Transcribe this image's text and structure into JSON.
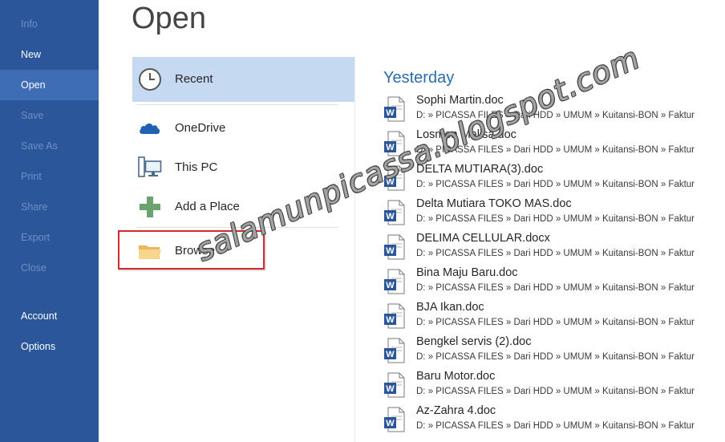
{
  "sidebar": {
    "items": [
      {
        "label": "Info",
        "state": "disabled"
      },
      {
        "label": "New",
        "state": "normal"
      },
      {
        "label": "Open",
        "state": "active"
      },
      {
        "label": "Save",
        "state": "disabled"
      },
      {
        "label": "Save As",
        "state": "disabled"
      },
      {
        "label": "Print",
        "state": "disabled"
      },
      {
        "label": "Share",
        "state": "disabled"
      },
      {
        "label": "Export",
        "state": "disabled"
      },
      {
        "label": "Close",
        "state": "disabled"
      },
      {
        "label": "Account",
        "state": "normal"
      },
      {
        "label": "Options",
        "state": "normal"
      }
    ]
  },
  "page": {
    "title": "Open"
  },
  "places": [
    {
      "label": "Recent",
      "icon": "clock-icon",
      "selected": true
    },
    {
      "label": "OneDrive",
      "icon": "cloud-icon"
    },
    {
      "label": "This PC",
      "icon": "computer-icon"
    },
    {
      "label": "Add a Place",
      "icon": "plus-icon"
    },
    {
      "label": "Browse",
      "icon": "folder-icon"
    }
  ],
  "recent": {
    "group_label": "Yesterday",
    "files": [
      {
        "name": "Sophi Martin.doc",
        "path": "D: » PICASSA FILES » Dari HDD » UMUM » Kuitansi-BON » Faktur"
      },
      {
        "name": "Losmen Malisa.doc",
        "path": "D: » PICASSA FILES » Dari HDD » UMUM » Kuitansi-BON » Faktur"
      },
      {
        "name": "DELTA MUTIARA(3).doc",
        "path": "D: » PICASSA FILES » Dari HDD » UMUM » Kuitansi-BON » Faktur"
      },
      {
        "name": "Delta Mutiara TOKO MAS.doc",
        "path": "D: » PICASSA FILES » Dari HDD » UMUM » Kuitansi-BON » Faktur"
      },
      {
        "name": "DELIMA CELLULAR.docx",
        "path": "D: » PICASSA FILES » Dari HDD » UMUM » Kuitansi-BON » Faktur"
      },
      {
        "name": "Bina Maju Baru.doc",
        "path": "D: » PICASSA FILES » Dari HDD » UMUM » Kuitansi-BON » Faktur"
      },
      {
        "name": "BJA Ikan.doc",
        "path": "D: » PICASSA FILES » Dari HDD » UMUM » Kuitansi-BON » Faktur"
      },
      {
        "name": "Bengkel servis (2).doc",
        "path": "D: » PICASSA FILES » Dari HDD » UMUM » Kuitansi-BON » Faktur"
      },
      {
        "name": "Baru Motor.doc",
        "path": "D: » PICASSA FILES » Dari HDD » UMUM » Kuitansi-BON » Faktur"
      },
      {
        "name": "Az-Zahra 4.doc",
        "path": "D: » PICASSA FILES » Dari HDD » UMUM » Kuitansi-BON » Faktur"
      }
    ]
  },
  "watermark": "salamunpicassa.blogspot.com",
  "colors": {
    "sidebar": "#2b579a",
    "sidebar_active": "#3e6db5",
    "selected_place": "#c5d9f1",
    "accent_text": "#2b6cb0",
    "highlight_border": "#d42a2a"
  }
}
